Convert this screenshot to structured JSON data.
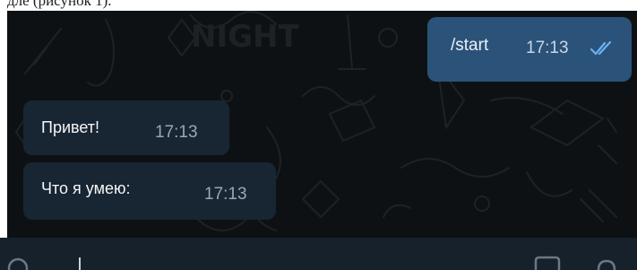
{
  "messages": [
    {
      "direction": "outgoing",
      "text": "/start",
      "time": "17:13",
      "status_icon": "double-check-icon"
    },
    {
      "direction": "incoming",
      "text": "Привет!",
      "time": "17:13"
    },
    {
      "direction": "incoming",
      "text": "Что я умею:",
      "time": "17:13"
    }
  ],
  "colors": {
    "chat_background": "#0e1113",
    "outgoing_bubble": "#2b5278",
    "incoming_bubble": "#182533",
    "compose_bar": "#17212b",
    "read_ticks": "#6ab3f3"
  },
  "compose": {
    "icons": [
      "attach-icon",
      "sticker-icon",
      "mic-icon"
    ]
  }
}
